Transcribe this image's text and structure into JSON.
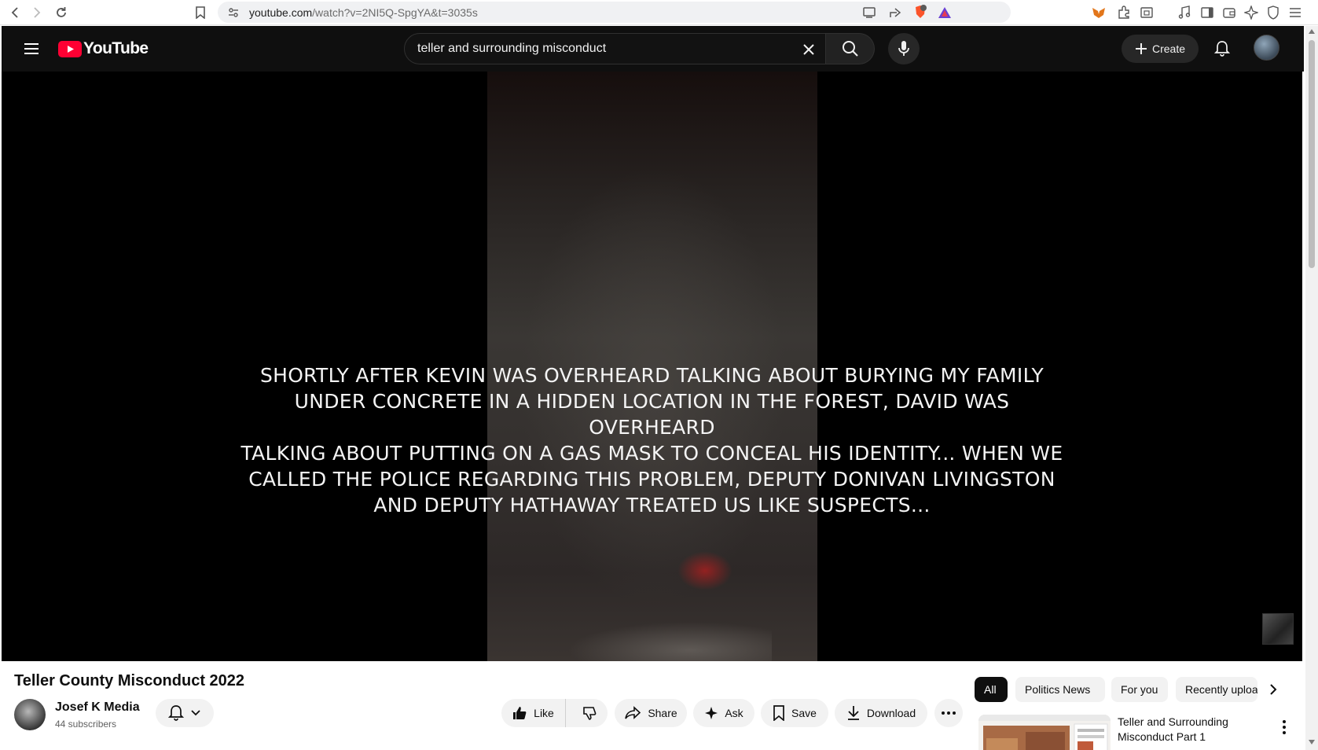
{
  "browser": {
    "url_host": "youtube.com",
    "url_path": "/watch?v=2NI5Q-SpgYA&t=3035s",
    "icons": [
      "back-icon",
      "forward-icon",
      "reload-icon",
      "bookmark-icon",
      "site-info-icon",
      "cast-icon",
      "share-icon",
      "brave-shields-icon",
      "brave-rewards-icon",
      "metamask-icon",
      "extensions-icon",
      "reader-icon",
      "media-icon",
      "sidebar-icon",
      "wallet-icon",
      "leo-ai-icon",
      "vpn-icon",
      "menu-icon"
    ],
    "shields_badge": "10"
  },
  "masthead": {
    "logo_text": "YouTube",
    "search_value": "teller and surrounding misconduct",
    "create_label": "Create",
    "brand_color": "#ff0033"
  },
  "video": {
    "caption": "SHORTLY AFTER KEVIN WAS OVERHEARD TALKING ABOUT BURYING MY FAMILY\nUNDER CONCRETE IN A HIDDEN LOCATION IN THE FOREST, DAVID WAS OVERHEARD\nTALKING ABOUT PUTTING ON A GAS MASK TO CONCEAL HIS IDENTITY...  WHEN WE\nCALLED THE POLICE REGARDING THIS PROBLEM, DEPUTY DONIVAN LIVINGSTON\nAND DEPUTY HATHAWAY TREATED US LIKE SUSPECTS..."
  },
  "meta": {
    "title": "Teller County Misconduct 2022",
    "channel_name": "Josef K Media",
    "subscribers": "44 subscribers"
  },
  "actions": {
    "like": "Like",
    "share": "Share",
    "ask": "Ask",
    "save": "Save",
    "download": "Download"
  },
  "chips": [
    "All",
    "Politics News",
    "For you",
    "Recently uploaded"
  ],
  "recommendation": {
    "title": "Teller and Surrounding Misconduct Part 1"
  }
}
